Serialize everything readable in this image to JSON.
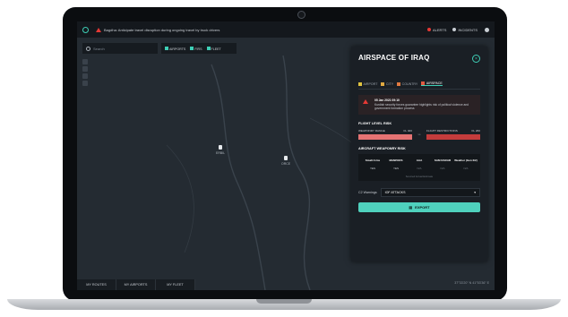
{
  "topbar": {
    "alert": "Bagdha: Anticipate travel disruption during ongoing travel by truck drivers",
    "alerts_label": "ALERTS",
    "incidents_label": "INCIDENTS"
  },
  "map": {
    "search_placeholder": "Search",
    "filters": [
      "AIRPORTS",
      "FIRS",
      "FLEET"
    ],
    "cities": [
      "ERBIL",
      "ORCE"
    ],
    "coords": "37°33'20\" N 41°53'36\" E",
    "bottom_tabs": [
      "MY ROUTES",
      "MY AIRPORTS",
      "MY FLEET"
    ]
  },
  "panel": {
    "title": "AIRSPACE OF IRAQ",
    "close": "×",
    "tabs": [
      {
        "label": "AIRPORT",
        "color": "#e0c341"
      },
      {
        "label": "CITY",
        "color": "#e0a941"
      },
      {
        "label": "COUNTRY",
        "color": "#e07a41"
      },
      {
        "label": "AIRSPACE",
        "color": "#e05a41"
      }
    ],
    "alert_date": "05 Jan 2021 09:10",
    "alert_text": "Kurdish security forces guarantee highlights risk of political violence and government formation process",
    "flight_level_title": "FLIGHT LEVEL RISK",
    "risk_left_label": "WEAPONRY RANGE",
    "risk_left_value": "FL 400",
    "risk_vs": "vs",
    "risk_right_label": "FLIGHT RESTRICTIONS",
    "risk_right_value": "FL 260",
    "weaponry_title": "AIRCRAFT WEAPONRY RISK",
    "table": {
      "headers": [
        "Small Arms",
        "MANPADS",
        "AAA",
        "SAM RADAR",
        "Weather (Gen 2/2)"
      ],
      "row": [
        "YES",
        "YES",
        "N/A",
        "N/A",
        "N/A"
      ],
      "note": "Sourced Actual Estimate"
    },
    "warning_label": "C2 Warnings",
    "warning_value": "IOF ATTACKS",
    "export_label": "EXPORT"
  }
}
